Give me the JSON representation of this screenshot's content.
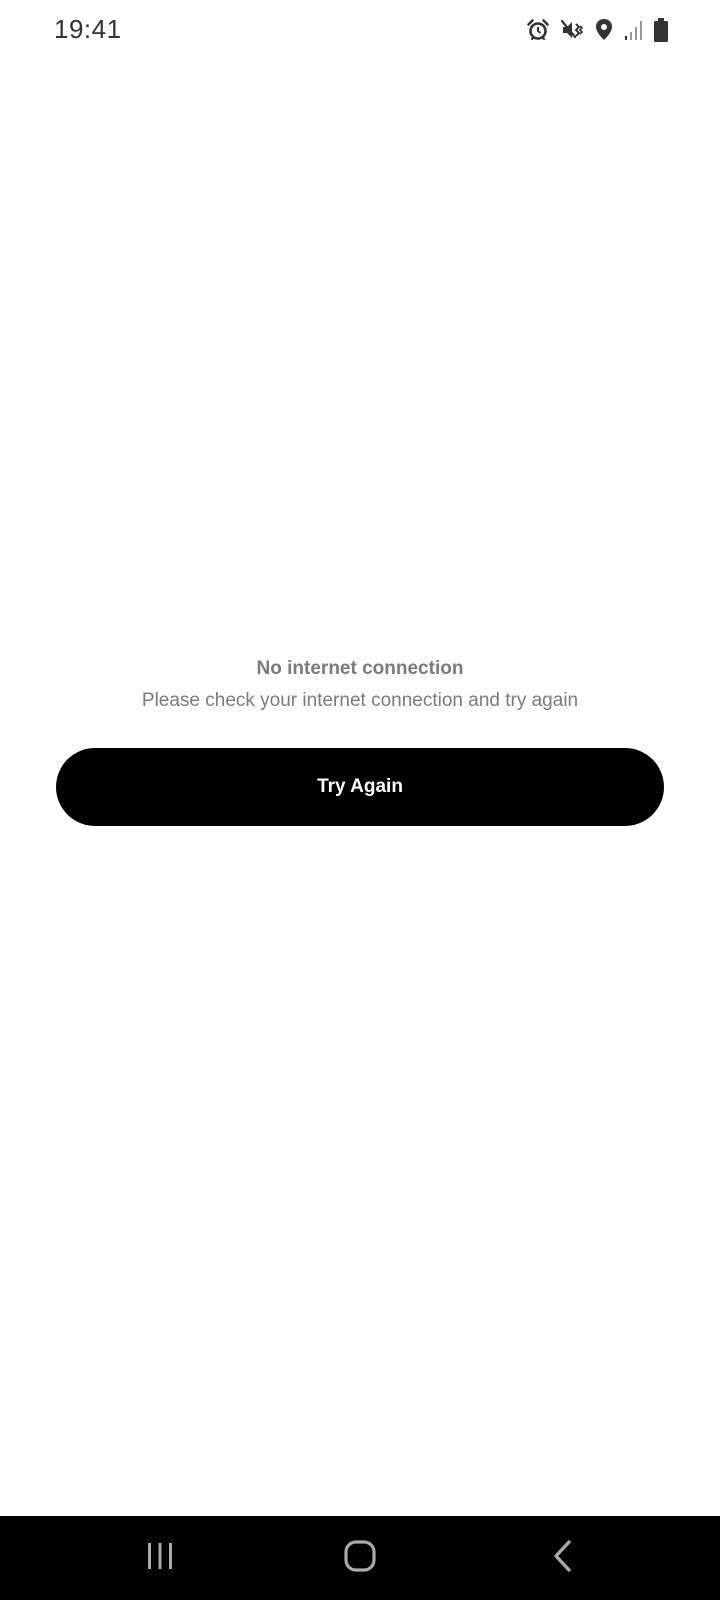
{
  "status_bar": {
    "time": "19:41",
    "icons": [
      "alarm-icon",
      "mute-vibrate-icon",
      "location-icon",
      "signal-icon",
      "battery-icon"
    ]
  },
  "message": {
    "title": "No internet connection",
    "subtitle": "Please check your internet connection and try again"
  },
  "actions": {
    "try_again_label": "Try Again"
  },
  "nav_bar": {
    "buttons": [
      "recents-icon",
      "home-icon",
      "back-icon"
    ]
  },
  "colors": {
    "text_muted": "#7b7b7b",
    "button_bg": "#000000",
    "button_text": "#ffffff",
    "nav_bg": "#000000"
  }
}
